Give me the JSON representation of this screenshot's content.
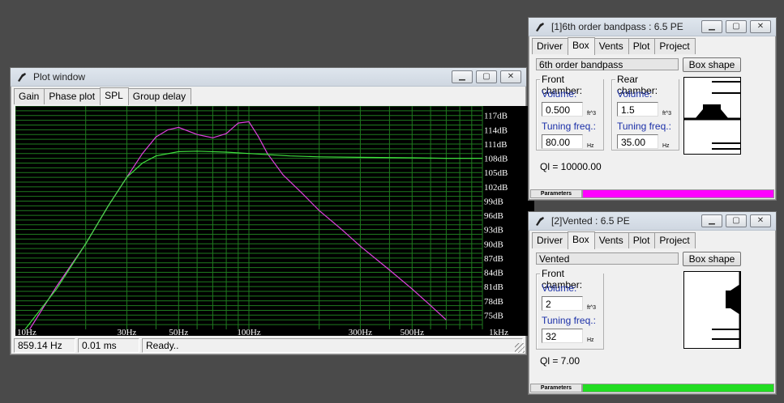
{
  "plot_window": {
    "title": "Plot window",
    "tabs": [
      {
        "label": "Gain",
        "active": false
      },
      {
        "label": "Phase plot",
        "active": false
      },
      {
        "label": "SPL",
        "active": true
      },
      {
        "label": "Group delay",
        "active": false
      }
    ],
    "status": {
      "freq": "859.14 Hz",
      "time": "0.01 ms",
      "message": "Ready.."
    }
  },
  "chart_data": {
    "type": "line",
    "x_scale": "log",
    "xlim": [
      10,
      1000
    ],
    "ylim": [
      72,
      119
    ],
    "x_tick_labels": [
      {
        "value": 10,
        "label": "10Hz"
      },
      {
        "value": 30,
        "label": "30Hz"
      },
      {
        "value": 50,
        "label": "50Hz"
      },
      {
        "value": 100,
        "label": "100Hz"
      },
      {
        "value": 300,
        "label": "300Hz"
      },
      {
        "value": 500,
        "label": "500Hz"
      },
      {
        "value": 1000,
        "label": "1kHz"
      }
    ],
    "y_tick_labels": [
      {
        "value": 117,
        "label": "117dB"
      },
      {
        "value": 114,
        "label": "114dB"
      },
      {
        "value": 111,
        "label": "111dB"
      },
      {
        "value": 108,
        "label": "108dB"
      },
      {
        "value": 105,
        "label": "105dB"
      },
      {
        "value": 102,
        "label": "102dB"
      },
      {
        "value": 99,
        "label": "99dB"
      },
      {
        "value": 96,
        "label": "96dB"
      },
      {
        "value": 93,
        "label": "93dB"
      },
      {
        "value": 90,
        "label": "90dB"
      },
      {
        "value": 87,
        "label": "87dB"
      },
      {
        "value": 84,
        "label": "84dB"
      },
      {
        "value": 81,
        "label": "81dB"
      },
      {
        "value": 78,
        "label": "78dB"
      },
      {
        "value": 75,
        "label": "75dB"
      }
    ],
    "grid": true,
    "background": "#000000",
    "grid_color": "#1f7a1f",
    "series": [
      {
        "color": "#e040e0",
        "x": [
          11.5,
          15,
          20,
          25,
          30,
          35,
          40,
          45,
          50,
          60,
          70,
          80,
          90,
          100,
          110,
          120,
          140,
          170,
          200,
          250,
          300,
          400,
          500,
          600,
          700
        ],
        "y": [
          72,
          81,
          90,
          98,
          104,
          109,
          112.5,
          114,
          114.5,
          113,
          112.3,
          113.2,
          115.4,
          115.7,
          112.5,
          109,
          104.5,
          100.5,
          97,
          93,
          89.5,
          84.5,
          80.5,
          77,
          74
        ]
      },
      {
        "color": "#40e040",
        "x": [
          11,
          15,
          20,
          25,
          30,
          35,
          40,
          50,
          60,
          80,
          100,
          150,
          200,
          300,
          500,
          700,
          1000
        ],
        "y": [
          72,
          80.5,
          90,
          98,
          104,
          107,
          108.5,
          109.4,
          109.5,
          109.3,
          109,
          108.5,
          108.3,
          108.2,
          108.1,
          108,
          108
        ]
      }
    ]
  },
  "bandpass_window": {
    "title": "[1]6th order bandpass : 6.5 PE",
    "tabs": [
      {
        "label": "Driver",
        "active": false
      },
      {
        "label": "Box",
        "active": true
      },
      {
        "label": "Vents",
        "active": false
      },
      {
        "label": "Plot",
        "active": false
      },
      {
        "label": "Project",
        "active": false
      }
    ],
    "box_type": "6th order bandpass",
    "box_shape_button": "Box shape",
    "front": {
      "title": "Front chamber:",
      "volume_label": "Volume:",
      "volume": "0.500",
      "volume_unit": "ft^3",
      "tuning_label": "Tuning freq.:",
      "tuning": "80.00",
      "tuning_unit": "Hz"
    },
    "rear": {
      "title": "Rear chamber:",
      "volume_label": "Volume:",
      "volume": "1.5",
      "volume_unit": "ft^3",
      "tuning_label": "Tuning freq.:",
      "tuning": "35.00",
      "tuning_unit": "Hz"
    },
    "ql": "Ql = 10000.00",
    "parameters_label": "Parameters",
    "color": "#ff00ff"
  },
  "vented_window": {
    "title": "[2]Vented : 6.5 PE",
    "tabs": [
      {
        "label": "Driver",
        "active": false
      },
      {
        "label": "Box",
        "active": true
      },
      {
        "label": "Vents",
        "active": false
      },
      {
        "label": "Plot",
        "active": false
      },
      {
        "label": "Project",
        "active": false
      }
    ],
    "box_type": "Vented",
    "box_shape_button": "Box shape",
    "front": {
      "title": "Front chamber:",
      "volume_label": "Volume:",
      "volume": "2",
      "volume_unit": "ft^3",
      "tuning_label": "Tuning freq.:",
      "tuning": "32",
      "tuning_unit": "Hz"
    },
    "ql": "Ql = 7.00",
    "parameters_label": "Parameters",
    "color": "#22dd22"
  },
  "icons": {
    "app": "speaker-app-icon",
    "minimize": "minimize-icon",
    "maximize": "maximize-icon",
    "close": "close-icon"
  }
}
